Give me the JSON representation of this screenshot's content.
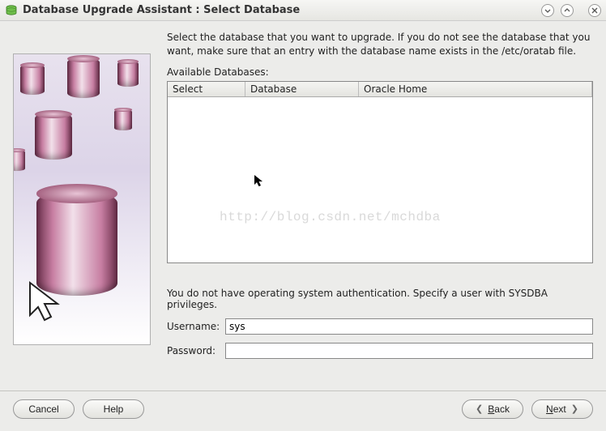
{
  "window": {
    "title": "Database Upgrade Assistant : Select Database"
  },
  "intro": "Select the database that you want to upgrade. If you do not see the database that you want, make sure that an entry with the database name exists in the /etc/oratab file.",
  "available_label": "Available Databases:",
  "table": {
    "columns": {
      "select": "Select",
      "database": "Database",
      "home": "Oracle Home"
    },
    "rows": []
  },
  "watermark": "http://blog.csdn.net/mchdba",
  "auth_message": "You do not have operating system authentication. Specify a user with SYSDBA privileges.",
  "fields": {
    "username_label": "Username:",
    "username_value": "sys",
    "password_label": "Password:",
    "password_value": ""
  },
  "buttons": {
    "cancel": "Cancel",
    "help": "Help",
    "back_label": "Back",
    "back_underline": "B",
    "next_label": "Next",
    "next_underline": "N"
  }
}
